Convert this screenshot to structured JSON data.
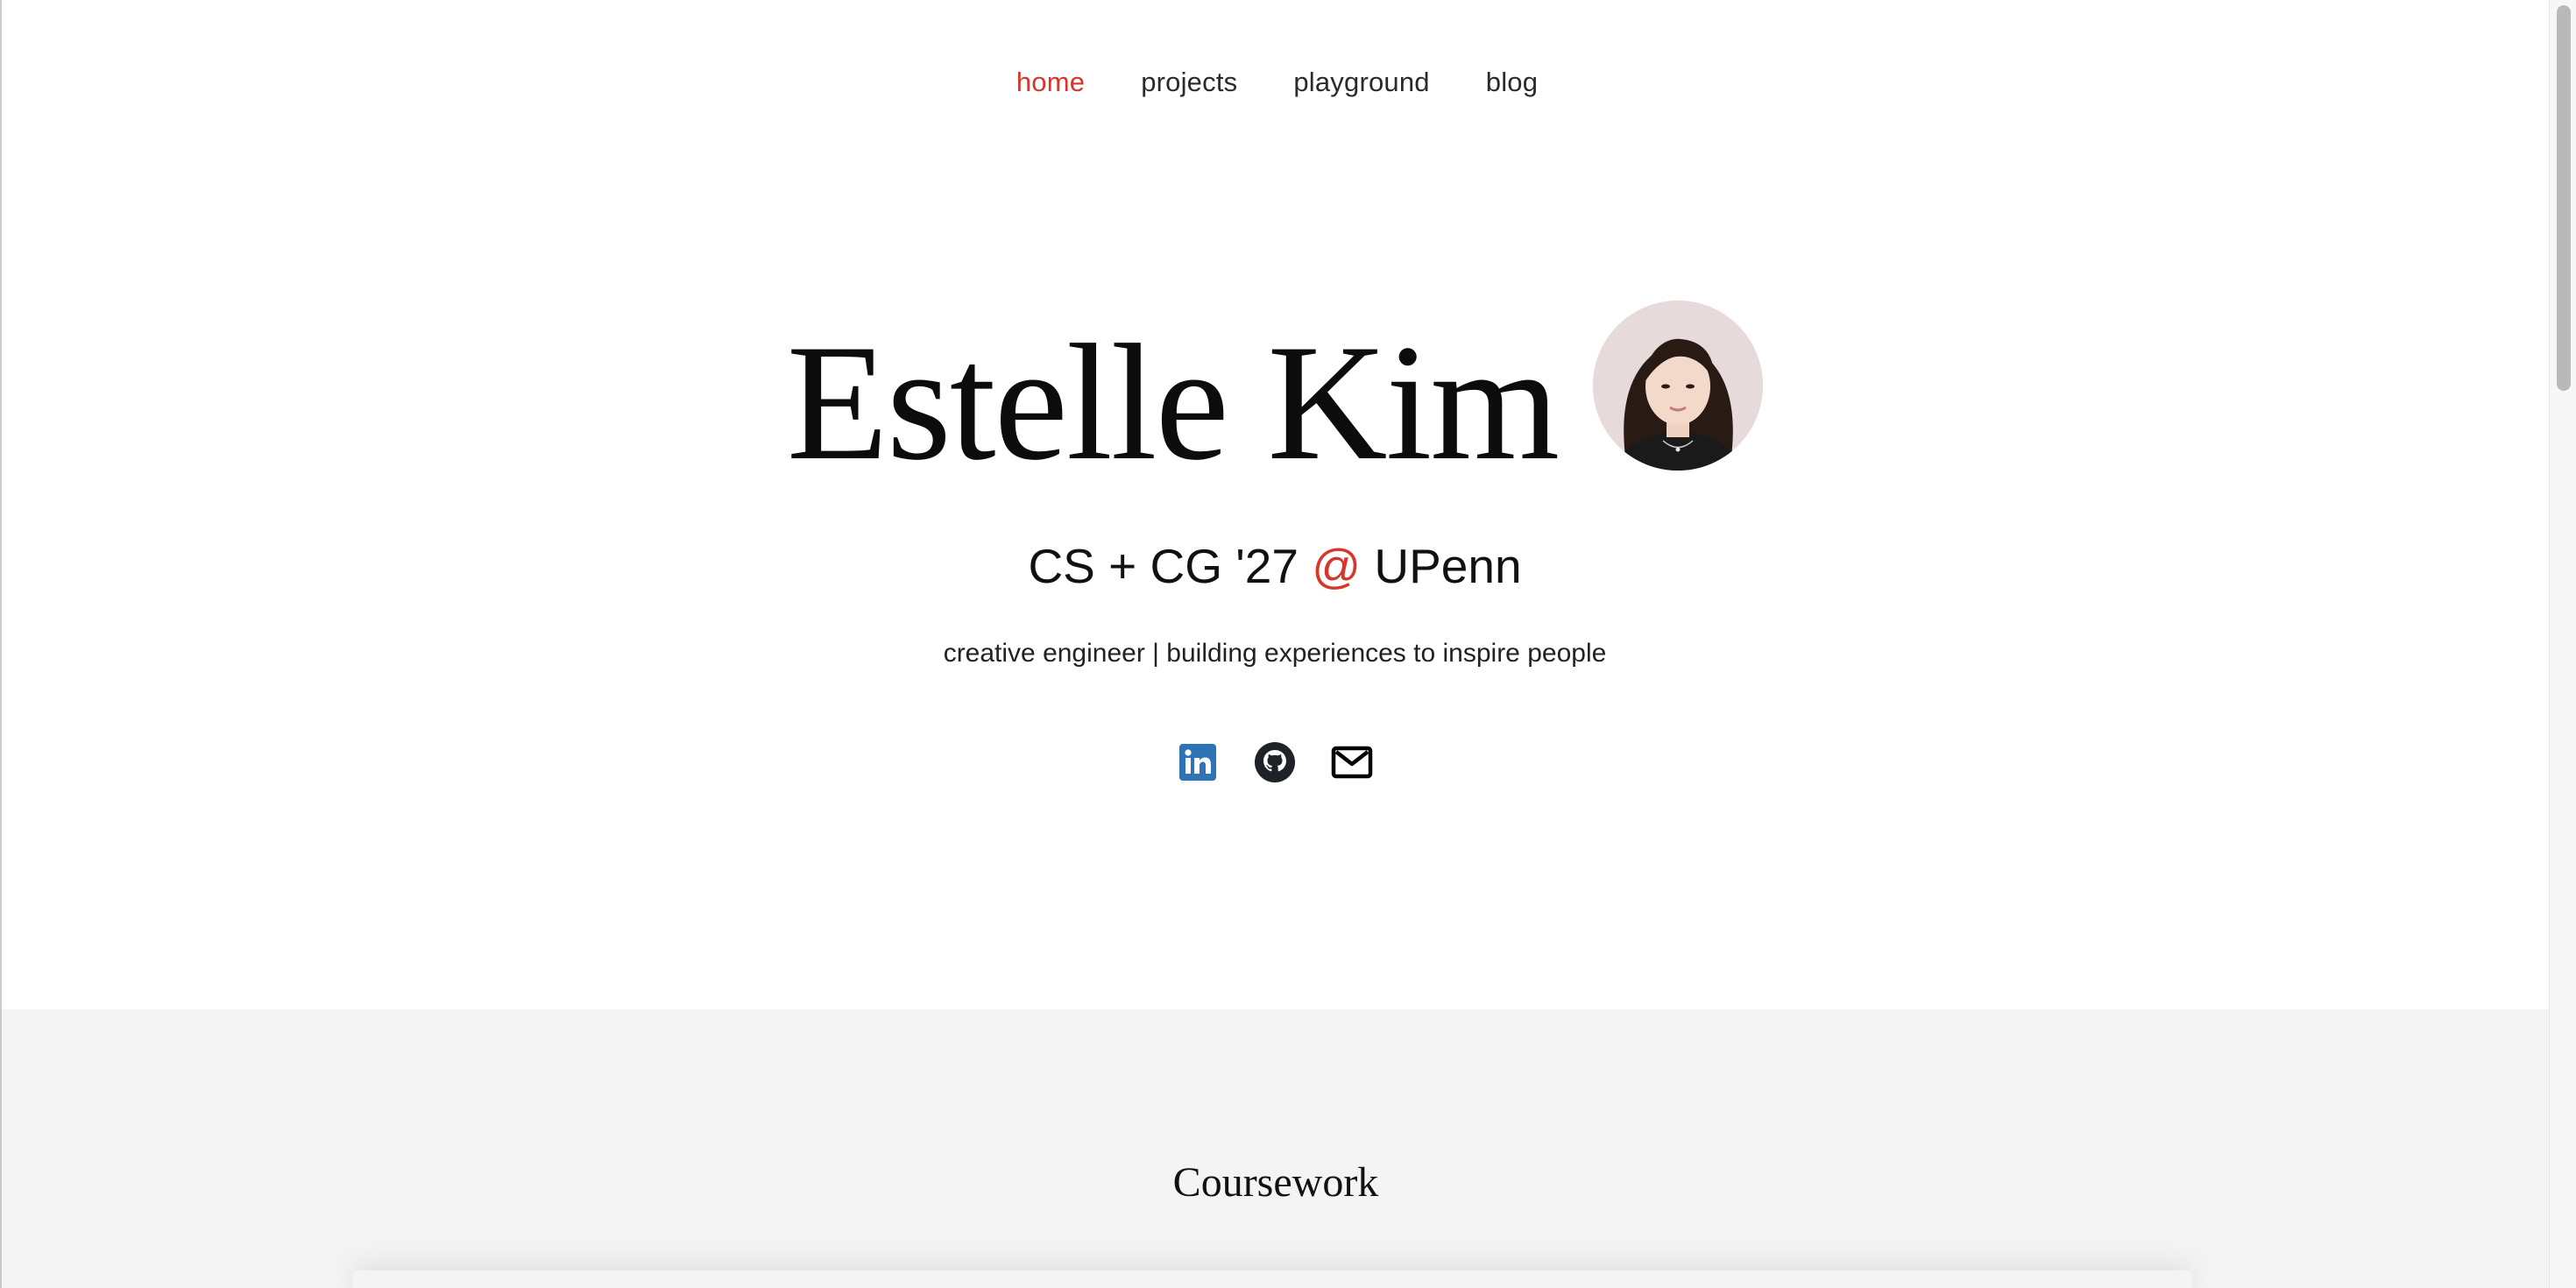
{
  "nav": {
    "items": [
      {
        "label": "home",
        "active": true
      },
      {
        "label": "projects",
        "active": false
      },
      {
        "label": "playground",
        "active": false
      },
      {
        "label": "blog",
        "active": false
      }
    ]
  },
  "hero": {
    "name": "Estelle Kim",
    "subtitle_prefix": "CS + CG '27 ",
    "subtitle_at": "@",
    "subtitle_suffix": " UPenn",
    "tagline": "creative engineer | building experiences to inspire people"
  },
  "socials": [
    {
      "icon": "linkedin-icon"
    },
    {
      "icon": "github-icon"
    },
    {
      "icon": "mail-icon"
    }
  ],
  "coursework": {
    "title": "Coursework"
  },
  "colors": {
    "accent": "#d6362b",
    "text": "#111111",
    "section_bg": "#f4f4f4",
    "linkedin": "#2f73b7"
  }
}
